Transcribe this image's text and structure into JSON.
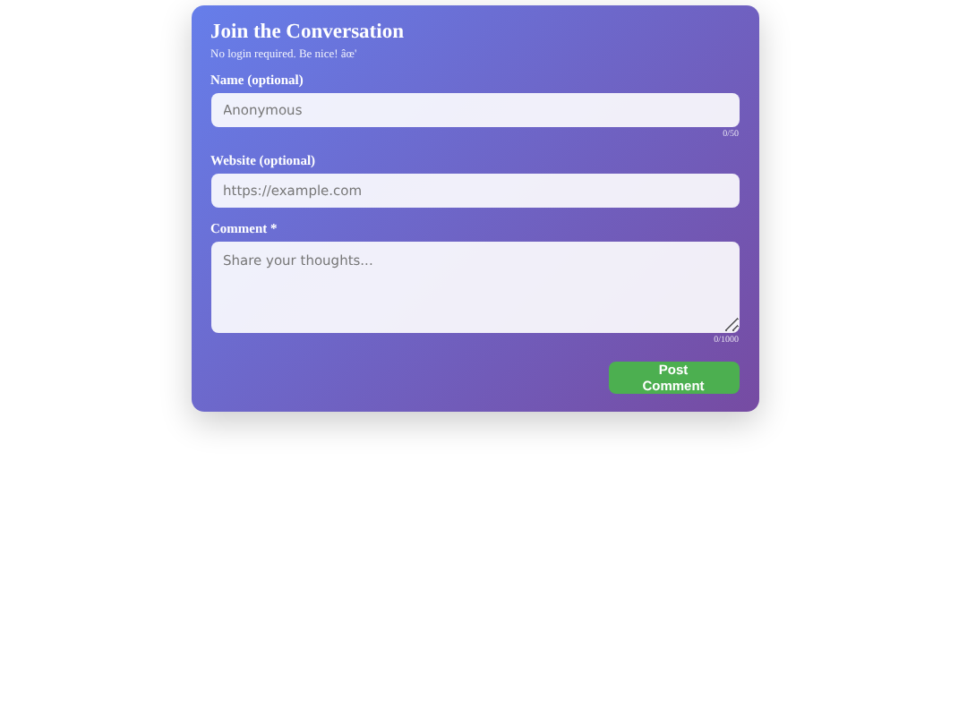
{
  "title": "Join the Conversation",
  "subtitle": "No login required. Be nice! âœ'",
  "fields": [
    {
      "kind": "input",
      "label": "Name (optional)",
      "placeholder": "Anonymous",
      "counter": "0/50"
    },
    {
      "kind": "input",
      "label": "Website (optional)",
      "placeholder": "https://example.com"
    },
    {
      "kind": "textarea",
      "label": "Comment *",
      "placeholder": "Share your thoughts...",
      "counter": "0/1000"
    }
  ],
  "submit": "Post Comment"
}
